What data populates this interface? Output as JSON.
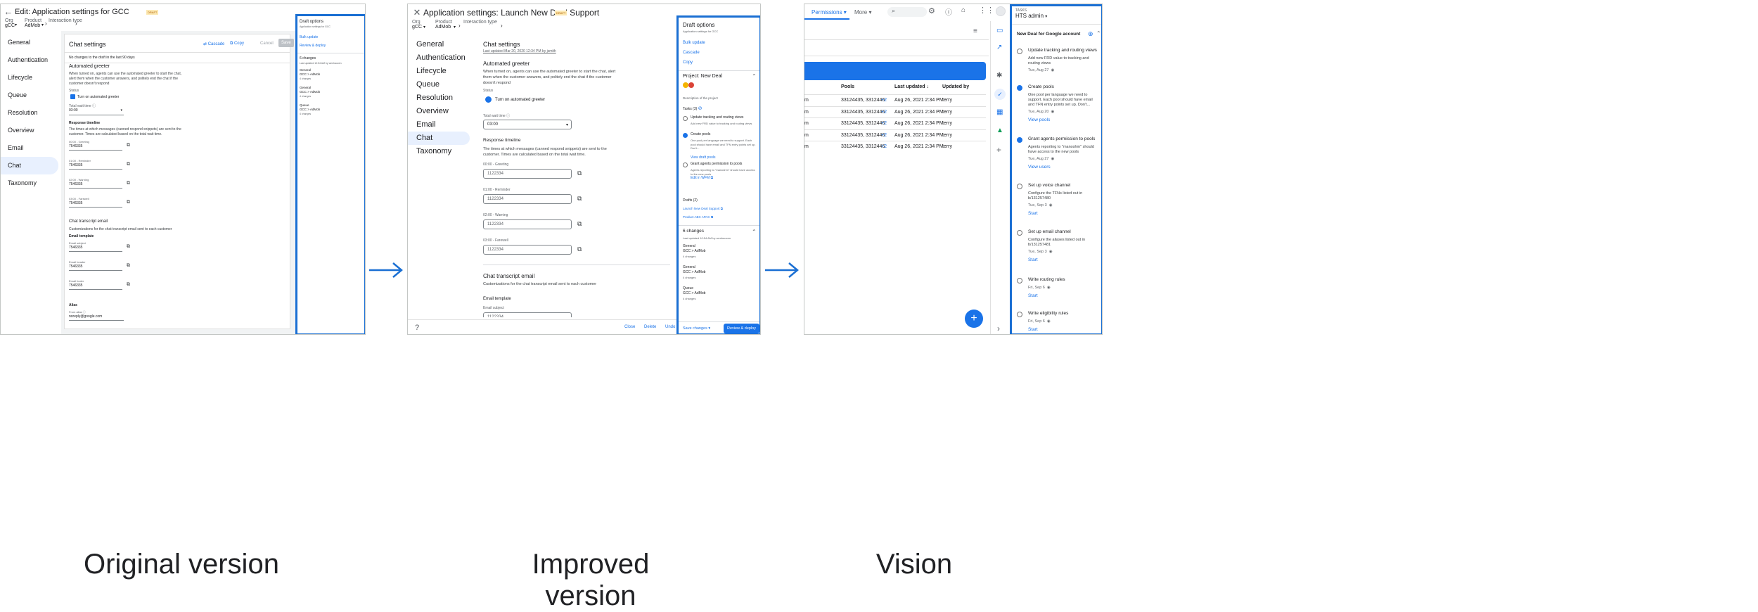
{
  "captions": {
    "original": "Original version",
    "improved": "Improved version",
    "vision": "Vision"
  },
  "p1": {
    "title": "Edit: Application settings for GCC",
    "badge": "DRAFT",
    "crumb": {
      "org_label": "Org",
      "org": "gCC",
      "product_label": "Product",
      "product": "AdMob",
      "interaction_label": "Interaction type"
    },
    "nav": [
      "General",
      "Authentication",
      "Lifecycle",
      "Queue",
      "Resolution",
      "Overview",
      "Email",
      "Chat",
      "Taxonomy"
    ],
    "heading": "Chat settings",
    "actions": {
      "cascade": "Cascade",
      "copy": "Copy",
      "cancel": "Cancel",
      "save": "Save"
    },
    "nochanges": "No changes to the draft in the last 90 days",
    "greeter": {
      "title": "Automated greeter",
      "desc": "When turned on, agents can use the automated greeter to start the chat, alert them when the customer answers, and politely end the chat if the customer doesn't respond",
      "status_label": "Status",
      "checkbox": "Turn on automated greeter",
      "wait_label": "Total wait time",
      "wait": "03:00"
    },
    "timeline": {
      "title": "Response timeline",
      "desc": "The times at which messages (canned respond snippets) are sent to the customer. Times are calculated based on the total wait time.",
      "items": [
        {
          "label": "00:00 - Greeting",
          "value": "7546335"
        },
        {
          "label": "01:00 - Reminder",
          "value": "7546335"
        },
        {
          "label": "02:00 - Warning",
          "value": "7546335"
        },
        {
          "label": "03:00 - Farewell",
          "value": "7546335"
        }
      ]
    },
    "transcript": {
      "title": "Chat transcript email",
      "desc": "Customizations for the chat transcript email sent to each customer",
      "template": "Email template",
      "fields": [
        {
          "label": "Email subject",
          "value": "7546335"
        },
        {
          "label": "Email header",
          "value": "7546335"
        },
        {
          "label": "Email footer",
          "value": "7546335"
        }
      ]
    },
    "alias": {
      "title": "Alias",
      "label": "From alias",
      "value": "noreply@google.com"
    },
    "draft": {
      "title": "Draft options",
      "sub": "Application settings for GCC",
      "bulk": "Bulk update",
      "review": "Review & deploy",
      "changes": "6 changes",
      "updated": "Last updated 10:54 AM by wenhaocen",
      "groups": [
        {
          "name": "General",
          "path": "GCC > AdMob",
          "count": "4 changes"
        },
        {
          "name": "General",
          "path": "GCC > AdMob",
          "count": "4 changes"
        },
        {
          "name": "Queue",
          "path": "GCC > AdMob",
          "count": "4 changes"
        }
      ]
    }
  },
  "p2": {
    "title": "Application settings: Launch New Deal Support",
    "badge": "DRAFT",
    "crumb": {
      "org_label": "Org",
      "org": "gCC",
      "product_label": "Product",
      "product": "AdMob",
      "interaction_label": "Interaction type"
    },
    "nav": [
      "General",
      "Authentication",
      "Lifecycle",
      "Queue",
      "Resolution",
      "Overview",
      "Email",
      "Chat",
      "Taxonomy"
    ],
    "heading": "Chat settings",
    "updated": "Last updated Mar 20, 2020 12:34 PM by jsmith",
    "greeter": {
      "title": "Automated greeter",
      "desc": "When turned on, agents can use the automated greeter to start the chat, alert them when the customer answers, and politely end the chat if the customer doesn't respond",
      "status_label": "Status",
      "radio": "Turn on automated greeter",
      "wait_label": "Total wait time",
      "wait": "03:00"
    },
    "timeline": {
      "title": "Response timeline",
      "desc": "The times at which messages (canned respond snippets) are sent to the customer. Times are calculated based on the total wait time.",
      "items": [
        {
          "label": "00:00 - Greeting",
          "value": "1122334"
        },
        {
          "label": "01:00 - Reminder",
          "value": "1122334"
        },
        {
          "label": "02:00 - Warning",
          "value": "1122334"
        },
        {
          "label": "03:00 - Farewell",
          "value": "1122334"
        }
      ]
    },
    "transcript": {
      "title": "Chat transcript email",
      "desc": "Customizations for the chat transcript email sent to each customer",
      "template": "Email template",
      "subject_label": "Email subject",
      "subject": "1122334"
    },
    "footer": {
      "close": "Close",
      "delete": "Delete",
      "undo": "Undo"
    },
    "draft": {
      "title": "Draft options",
      "sub": "Application settings for GCC",
      "bulk": "Bulk update",
      "cascade": "Cascade",
      "copy": "Copy",
      "project": "Project: New Deal",
      "project_desc": "Description of the project",
      "tasks_title": "Tasks (3)",
      "tasks": [
        {
          "title": "Update tracking and routing views",
          "desc": "Add new FRD value to tracking and routing views"
        },
        {
          "title": "Create pools",
          "desc": "One pool per language we need to support. Each pool should have email and TFN entry points set up. Don't...",
          "link": "View draft pools"
        },
        {
          "title": "Grant agents permission to pools",
          "desc": "Agents reporting to \"manoshm\" should have access to the new pools",
          "link": "Edit in WFM"
        }
      ],
      "drafts_title": "Drafts (2)",
      "drafts": [
        "Launch New Deal Support",
        "Product ABC APAC"
      ],
      "changes": "6 changes",
      "changes_updated": "Last updated 10:54 AM by wenhaocen",
      "groups": [
        {
          "name": "General",
          "path": "GCC > AdMob",
          "count": "4 changes"
        },
        {
          "name": "General",
          "path": "GCC > AdMob",
          "count": "4 changes"
        },
        {
          "name": "Queue",
          "path": "GCC > AdMob",
          "count": "4 changes"
        }
      ],
      "save": "Save changes",
      "deploy": "Review & deploy"
    }
  },
  "p3": {
    "tabs": {
      "permissions": "Permissions",
      "more": "More"
    },
    "table": {
      "headers": [
        "Pools",
        "Last updated",
        "Updated by"
      ],
      "rows": [
        {
          "pre": "m",
          "pools": "33124435, 3312446",
          "plus": "+2",
          "updated": "Aug 26, 2021 2:34 PM",
          "by": "terry"
        },
        {
          "pre": "m",
          "pools": "33124435, 3312446",
          "plus": "+2",
          "updated": "Aug 26, 2021 2:34 PM",
          "by": "terry"
        },
        {
          "pre": "m",
          "pools": "33124435, 3312446",
          "plus": "+2",
          "updated": "Aug 26, 2021 2:34 PM",
          "by": "terry"
        },
        {
          "pre": "m",
          "pools": "33124435, 3312446",
          "plus": "+2",
          "updated": "Aug 26, 2021 2:34 PM",
          "by": "terry"
        },
        {
          "pre": "m",
          "pools": "33124435, 3312446",
          "plus": "+2",
          "updated": "Aug 26, 2021 2:34 PM",
          "by": "terry"
        }
      ]
    },
    "tasks": {
      "label": "TASKS",
      "owner": "HTS admin",
      "list": "New Deal for Google account",
      "items": [
        {
          "title": "Update tracking and routing views",
          "desc": "Add new FRD value to tracking and routing views",
          "date": "Tue, Aug 27"
        },
        {
          "title": "Create pools",
          "desc": "One pool per language we need to support. Each pool should have email and TFN entry points set up. Don't...",
          "date": "Tue, Aug 20",
          "action": "View pools"
        },
        {
          "title": "Grant agents permission to pools",
          "desc": "Agents reporting to \"manoshm\" should have access to the new pools",
          "date": "Tue, Aug 27",
          "action": "View users"
        },
        {
          "title": "Set up voice channel",
          "desc": "Configure the TFNs listed out in b/131257480",
          "date": "Tue, Sep 3",
          "action": "Start"
        },
        {
          "title": "Set up email channel",
          "desc": "Configure the aliases listed out in b/131257481",
          "date": "Tue, Sep 3",
          "action": "Start"
        },
        {
          "title": "Write routing rules",
          "date": "Fri, Sep 6",
          "action": "Start"
        },
        {
          "title": "Write eligibility rules",
          "date": "Fri, Sep 6",
          "action": "Start"
        }
      ]
    }
  }
}
